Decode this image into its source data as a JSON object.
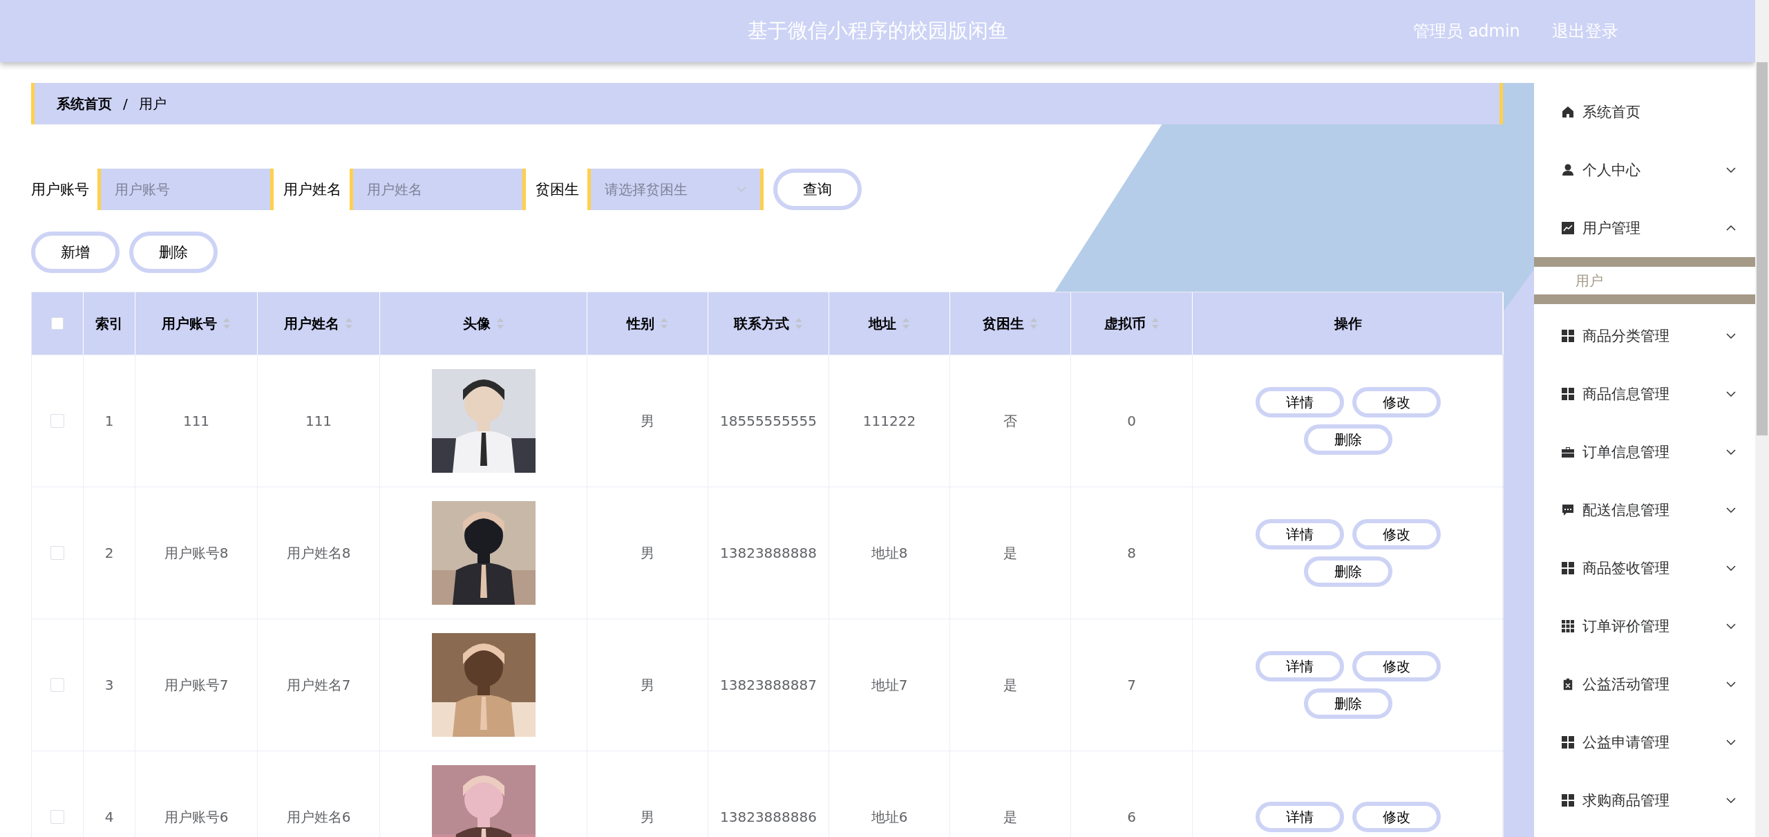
{
  "header": {
    "title": "基于微信小程序的校园版闲鱼",
    "user": "管理员 admin",
    "logout": "退出登录"
  },
  "breadcrumb": [
    {
      "label": "系统首页",
      "selected": false
    },
    {
      "label": "/",
      "kind": "separator"
    },
    {
      "label": "用户",
      "selected": true
    }
  ],
  "search": {
    "fields": [
      {
        "label": "用户账号",
        "kind": "input",
        "placeholder": "用户账号"
      },
      {
        "label": "用户姓名",
        "kind": "input",
        "placeholder": "用户姓名"
      },
      {
        "label": "贫困生",
        "kind": "select",
        "placeholder": "请选择贫困生"
      }
    ],
    "button": "查询"
  },
  "actions": [
    "新增",
    "删除"
  ],
  "table": {
    "all_selected": false,
    "columns": [
      {
        "label": "索引",
        "sortable": false
      },
      {
        "label": "用户账号",
        "sortable": true
      },
      {
        "label": "用户姓名",
        "sortable": true
      },
      {
        "label": "头像",
        "sortable": true
      },
      {
        "label": "性别",
        "sortable": true
      },
      {
        "label": "联系方式",
        "sortable": true
      },
      {
        "label": "地址",
        "sortable": true
      },
      {
        "label": "贫困生",
        "sortable": true
      },
      {
        "label": "虚拟币",
        "sortable": true
      },
      {
        "label": "操作",
        "sortable": false
      }
    ],
    "rows": [
      {
        "selected": false,
        "index": "1",
        "account": "111",
        "name": "111",
        "avatar": {
          "kind": "picture"
        },
        "gender": "男",
        "phone": "18555555555",
        "address": "111222",
        "poor": "否",
        "coins": "0",
        "buttons": [
          "详情",
          "修改",
          "删除"
        ]
      },
      {
        "selected": false,
        "index": "2",
        "account": "用户账号8",
        "name": "用户姓名8",
        "avatar": {
          "kind": "picture"
        },
        "gender": "男",
        "phone": "13823888888",
        "address": "地址8",
        "poor": "是",
        "coins": "8",
        "buttons": [
          "详情",
          "修改",
          "删除"
        ]
      },
      {
        "selected": false,
        "index": "3",
        "account": "用户账号7",
        "name": "用户姓名7",
        "avatar": {
          "kind": "picture"
        },
        "gender": "男",
        "phone": "13823888887",
        "address": "地址7",
        "poor": "是",
        "coins": "7",
        "buttons": [
          "详情",
          "修改",
          "删除"
        ]
      },
      {
        "selected": false,
        "index": "4",
        "account": "用户账号6",
        "name": "用户姓名6",
        "avatar": {
          "kind": "picture"
        },
        "gender": "男",
        "phone": "13823888886",
        "address": "地址6",
        "poor": "是",
        "coins": "6",
        "buttons": [
          "详情",
          "修改"
        ]
      }
    ]
  },
  "sidebar": {
    "items": [
      {
        "label": "系统首页",
        "kind": "link"
      },
      {
        "label": "个人中心",
        "kind": "menu",
        "expanded": false
      },
      {
        "label": "用户管理",
        "kind": "menu",
        "expanded": true,
        "children": [
          {
            "label": "用户",
            "selected": true
          }
        ]
      },
      {
        "label": "商品分类管理",
        "kind": "menu",
        "expanded": false
      },
      {
        "label": "商品信息管理",
        "kind": "menu",
        "expanded": false
      },
      {
        "label": "订单信息管理",
        "kind": "menu",
        "expanded": false
      },
      {
        "label": "配送信息管理",
        "kind": "menu",
        "expanded": false
      },
      {
        "label": "商品签收管理",
        "kind": "menu",
        "expanded": false
      },
      {
        "label": "订单评价管理",
        "kind": "menu",
        "expanded": false
      },
      {
        "label": "公益活动管理",
        "kind": "menu",
        "expanded": false
      },
      {
        "label": "公益申请管理",
        "kind": "menu",
        "expanded": false
      },
      {
        "label": "求购商品管理",
        "kind": "menu",
        "expanded": false
      }
    ]
  }
}
